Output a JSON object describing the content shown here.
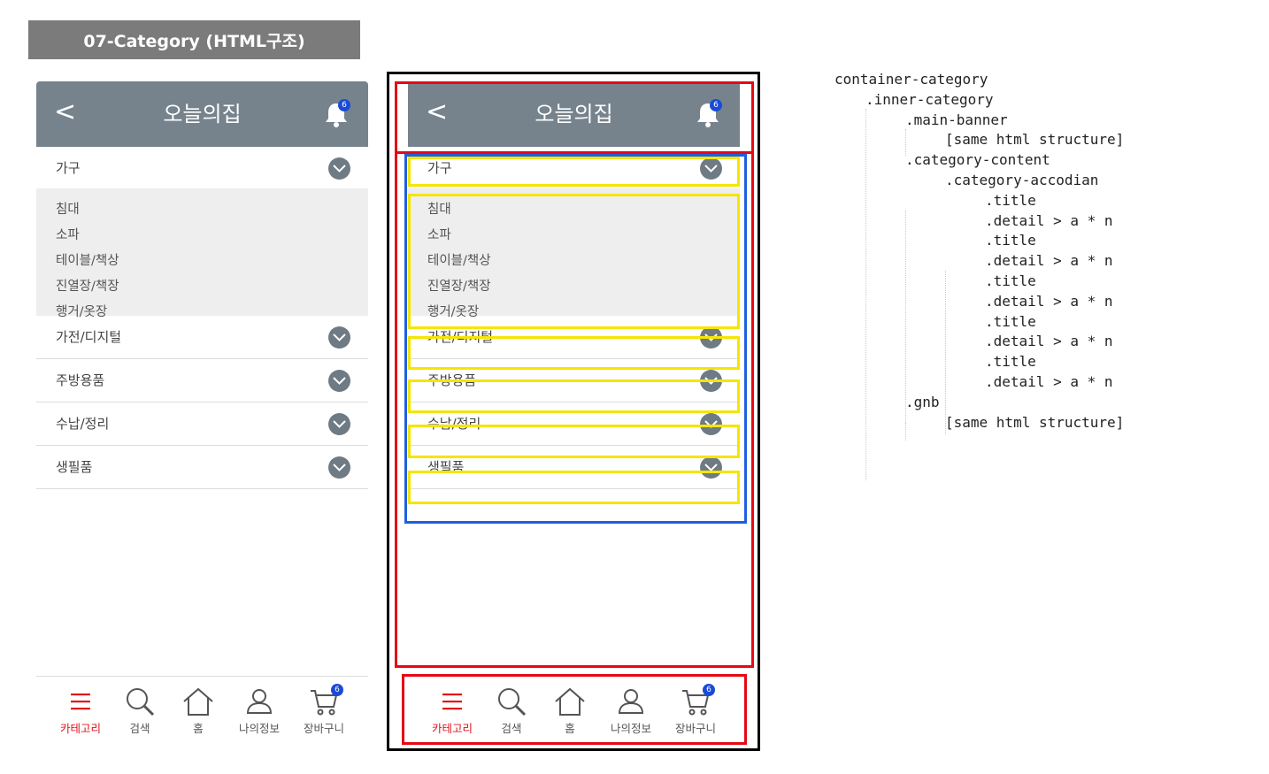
{
  "slide_title": "07-Category (HTML구조)",
  "app": {
    "back_label": "<",
    "title": "오늘의집",
    "notification_count": "6"
  },
  "categories": [
    {
      "title": "가구",
      "expanded": true,
      "items": [
        "침대",
        "소파",
        "테이블/책상",
        "진열장/책장",
        "행거/옷장"
      ]
    },
    {
      "title": "가전/디지털",
      "expanded": false,
      "items": []
    },
    {
      "title": "주방용품",
      "expanded": false,
      "items": []
    },
    {
      "title": "수납/정리",
      "expanded": false,
      "items": []
    },
    {
      "title": "생필품",
      "expanded": false,
      "items": []
    }
  ],
  "gnb": {
    "active": "카테고리",
    "cart_count": "6",
    "items": [
      {
        "label": "카테고리",
        "icon": "hamburger-icon"
      },
      {
        "label": "검색",
        "icon": "search-icon"
      },
      {
        "label": "홈",
        "icon": "home-icon"
      },
      {
        "label": "나의정보",
        "icon": "user-icon"
      },
      {
        "label": "장바구니",
        "icon": "cart-icon"
      }
    ]
  },
  "colors": {
    "header_bg": "#76838d",
    "accent_red": "#e0121a",
    "box_red": "#e50914",
    "box_blue": "#1e5fe0",
    "box_yellow": "#f5e500",
    "badge_blue": "#1a4bd6"
  },
  "code_lines": [
    "container-category",
    ".inner-category",
    ".main-banner",
    "[same html structure]",
    ".category-content",
    ".category-accodian",
    ".title",
    ".detail > a * n",
    ".title",
    ".detail > a * n",
    ".title",
    ".detail > a * n",
    ".title",
    ".detail > a * n",
    ".title",
    ".detail > a * n",
    ".gnb",
    "[same html structure]"
  ]
}
